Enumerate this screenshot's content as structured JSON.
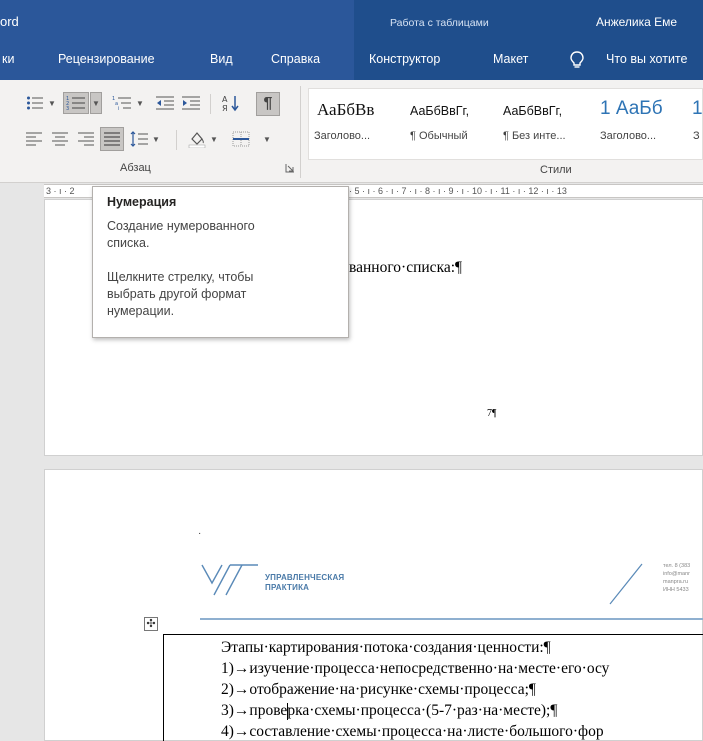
{
  "titlebar": {
    "app_fragment": "ord",
    "context_group": "Работа с таблицами",
    "user_name": "Анжелика Еме"
  },
  "tabs": {
    "items": [
      "ки",
      "Рецензирование",
      "Вид",
      "Справка",
      "Конструктор",
      "Макет",
      "Что вы хотите"
    ]
  },
  "ribbon": {
    "group_paragraph": "Абзац",
    "group_styles": "Стили",
    "styles": [
      {
        "sample": "АаБбВв",
        "name": "Заголово..."
      },
      {
        "sample": "АаБбВвГг,",
        "name": "¶ Обычный"
      },
      {
        "sample": "АаБбВвГг,",
        "name": "¶ Без инте..."
      },
      {
        "sample": "1 АаБб",
        "name": "Заголово..."
      },
      {
        "sample": "1",
        "name": "З"
      }
    ]
  },
  "ruler": {
    "left_text": "3 · ı · 2",
    "right_text": "ı · 5 · ı · 6 · ı · 7 · ı · 8 · ı · 9 · ı · 10 · ı · 11 · ı · 12 · ı · 13"
  },
  "tooltip": {
    "title": "Нумерация",
    "body": "Создание нумерованного\nсписка.\n\nЩелкните стрелку, чтобы\nвыбрать другой формат\nнумерации."
  },
  "page1": {
    "text_fragment": "ванного·списка:¶",
    "page_number": "7¶"
  },
  "page2": {
    "dot": "·",
    "logo_line1": "УПРАВЛЕНЧЕСКАЯ",
    "logo_line2": "ПРАКТИКА",
    "contacts": [
      "тел. 8 (383",
      "info@manr",
      "manpra.ru",
      "ИНН 5433"
    ],
    "move_handle": "✣",
    "lines": [
      "Этапы·картирования·потока·создания·ценности:¶",
      "1)→изучение·процесса·непосредственно·на·месте·его·осу",
      "2)→отображение·на·рисунке·схемы·процесса;¶",
      "3)→проверка·схемы·процесса·(5-7·раз·на·месте);¶",
      "4)→составление·схемы·процесса·на·листе·большого·фор"
    ]
  },
  "colors": {
    "title_bar": "#2b579a",
    "context_band": "#1f4e8c",
    "ribbon": "#f3f2f1",
    "workspace": "#e6e6e6",
    "logo_blue": "#4a7aa8"
  }
}
